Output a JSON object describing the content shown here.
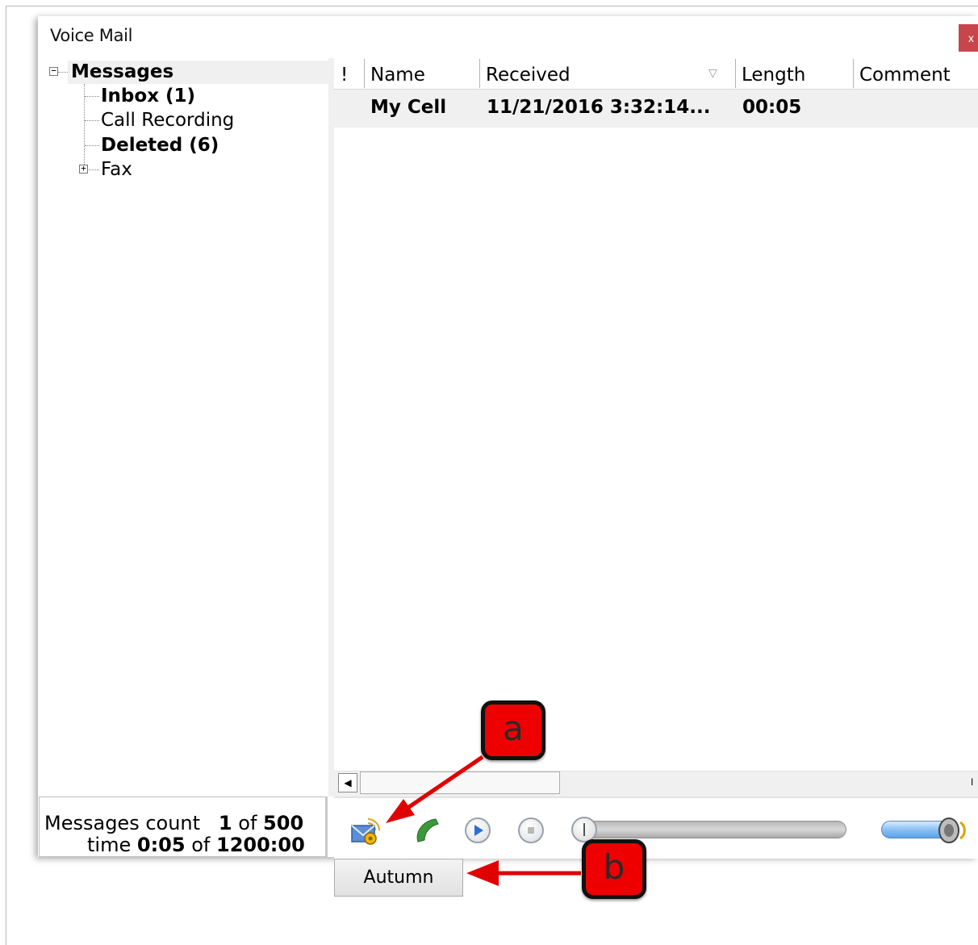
{
  "window": {
    "title": "Voice Mail",
    "close_label": "x"
  },
  "tree": {
    "root": {
      "label": "Messages",
      "expander": "−"
    },
    "items": [
      {
        "label": "Inbox (1)",
        "bold": true
      },
      {
        "label": "Call Recording",
        "bold": false
      },
      {
        "label": "Deleted (6)",
        "bold": true
      },
      {
        "label": "Fax",
        "bold": false,
        "expander": "+"
      }
    ]
  },
  "grid": {
    "columns": [
      "!",
      "Name",
      "Received",
      "Length",
      "Comment"
    ],
    "rows": [
      {
        "flag": "",
        "name": "My Cell",
        "received": "11/21/2016 3:32:14...",
        "length": "00:05",
        "comment": ""
      }
    ]
  },
  "scrollbar": {
    "left_arrow": "◀",
    "right_arrow": "I"
  },
  "status": {
    "count_label": "Messages count",
    "count_value": "1",
    "count_of": "of",
    "count_max": "500",
    "time_label": "time",
    "time_value": "0:05",
    "time_of": "of",
    "time_max": "1200:00"
  },
  "toolbar": {
    "icons": [
      "email-settings-icon",
      "phone-icon",
      "play-icon",
      "stop-icon"
    ],
    "autumn_label": "Autumn",
    "colors": {
      "volume": "#8cc1f5",
      "phone": "#3a9a3a"
    }
  },
  "annotations": {
    "a": "a",
    "b": "b",
    "color": "#ee0000"
  }
}
